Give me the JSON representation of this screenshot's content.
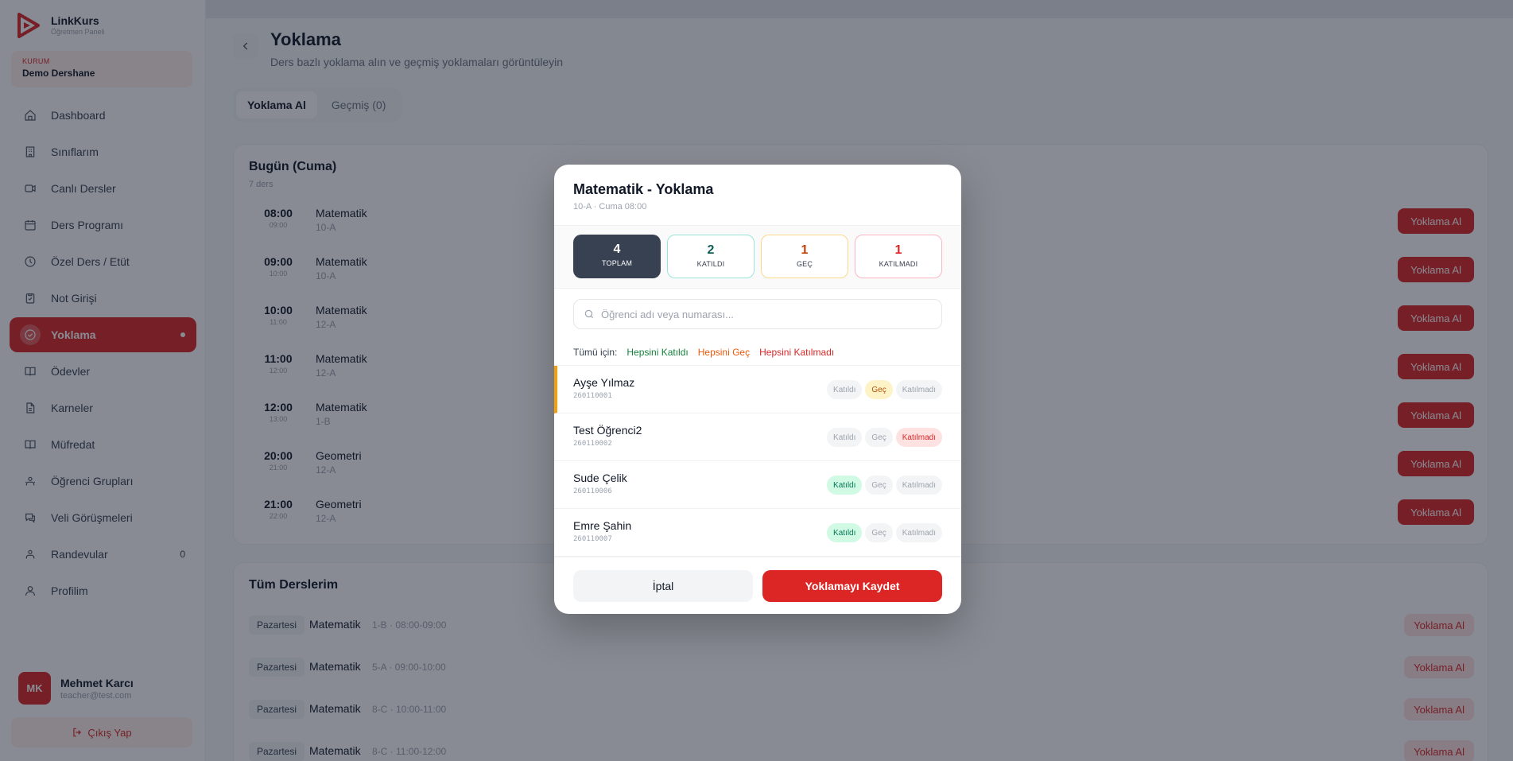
{
  "brand": {
    "name": "LinkKurs",
    "subtitle": "Öğretmen Paneli",
    "color": "#dc2626"
  },
  "institution": {
    "label": "KURUM",
    "name": "Demo Dershane"
  },
  "sidebar": {
    "items": [
      {
        "label": "Dashboard",
        "icon": "home-icon"
      },
      {
        "label": "Sınıflarım",
        "icon": "building-icon"
      },
      {
        "label": "Canlı Dersler",
        "icon": "video-icon"
      },
      {
        "label": "Ders Programı",
        "icon": "calendar-icon"
      },
      {
        "label": "Özel Ders / Etüt",
        "icon": "clock-icon"
      },
      {
        "label": "Not Girişi",
        "icon": "clipboard-icon"
      },
      {
        "label": "Yoklama",
        "icon": "check-circle-icon",
        "active": true
      },
      {
        "label": "Ödevler",
        "icon": "book-icon"
      },
      {
        "label": "Karneler",
        "icon": "file-icon"
      },
      {
        "label": "Müfredat",
        "icon": "book-open-icon"
      },
      {
        "label": "Öğrenci Grupları",
        "icon": "users-icon"
      },
      {
        "label": "Veli Görüşmeleri",
        "icon": "chat-icon"
      },
      {
        "label": "Randevular",
        "icon": "users-icon",
        "count": "0"
      },
      {
        "label": "Profilim",
        "icon": "user-icon"
      }
    ]
  },
  "user": {
    "initials": "MK",
    "name": "Mehmet Karcı",
    "email": "teacher@test.com"
  },
  "logout_label": "Çıkış Yap",
  "page": {
    "title": "Yoklama",
    "subtitle": "Ders bazlı yoklama alın ve geçmiş yoklamaları görüntüleyin",
    "tabs": [
      "Yoklama Al",
      "Geçmiş (0)"
    ]
  },
  "today": {
    "title": "Bugün (Cuma)",
    "count_label": "7 ders",
    "button_label": "Yoklama Al",
    "lessons": [
      {
        "start": "08:00",
        "end": "09:00",
        "subject": "Matematik",
        "class": "10-A"
      },
      {
        "start": "09:00",
        "end": "10:00",
        "subject": "Matematik",
        "class": "10-A"
      },
      {
        "start": "10:00",
        "end": "11:00",
        "subject": "Matematik",
        "class": "12-A"
      },
      {
        "start": "11:00",
        "end": "12:00",
        "subject": "Matematik",
        "class": "12-A"
      },
      {
        "start": "12:00",
        "end": "13:00",
        "subject": "Matematik",
        "class": "1-B"
      },
      {
        "start": "20:00",
        "end": "21:00",
        "subject": "Geometri",
        "class": "12-A"
      },
      {
        "start": "21:00",
        "end": "22:00",
        "subject": "Geometri",
        "class": "12-A"
      }
    ]
  },
  "all_lessons": {
    "title": "Tüm Derslerim",
    "button_label": "Yoklama Al",
    "rows": [
      {
        "day": "Pazartesi",
        "subject": "Matematik",
        "meta": "1-B · 08:00-09:00"
      },
      {
        "day": "Pazartesi",
        "subject": "Matematik",
        "meta": "5-A · 09:00-10:00"
      },
      {
        "day": "Pazartesi",
        "subject": "Matematik",
        "meta": "8-C · 10:00-11:00"
      },
      {
        "day": "Pazartesi",
        "subject": "Matematik",
        "meta": "8-C · 11:00-12:00"
      }
    ]
  },
  "modal": {
    "title": "Matematik - Yoklama",
    "subtitle": "10-A · Cuma 08:00",
    "stats": {
      "total": {
        "value": "4",
        "label": "TOPLAM"
      },
      "present": {
        "value": "2",
        "label": "KATILDI"
      },
      "late": {
        "value": "1",
        "label": "GEÇ"
      },
      "absent": {
        "value": "1",
        "label": "KATILMADI"
      }
    },
    "search_placeholder": "Öğrenci adı veya numarası...",
    "bulk": {
      "label": "Tümü için:",
      "present": "Hepsini Katıldı",
      "late": "Hepsini Geç",
      "absent": "Hepsini Katılmadı"
    },
    "status_labels": {
      "present": "Katıldı",
      "late": "Geç",
      "absent": "Katılmadı"
    },
    "students": [
      {
        "name": "Ayşe Yılmaz",
        "number": "260110001",
        "status": "late"
      },
      {
        "name": "Test Öğrenci2",
        "number": "260110002",
        "status": "absent"
      },
      {
        "name": "Sude Çelik",
        "number": "260110006",
        "status": "present"
      },
      {
        "name": "Emre Şahin",
        "number": "260110007",
        "status": "present"
      }
    ],
    "cancel_label": "İptal",
    "save_label": "Yoklamayı Kaydet"
  }
}
